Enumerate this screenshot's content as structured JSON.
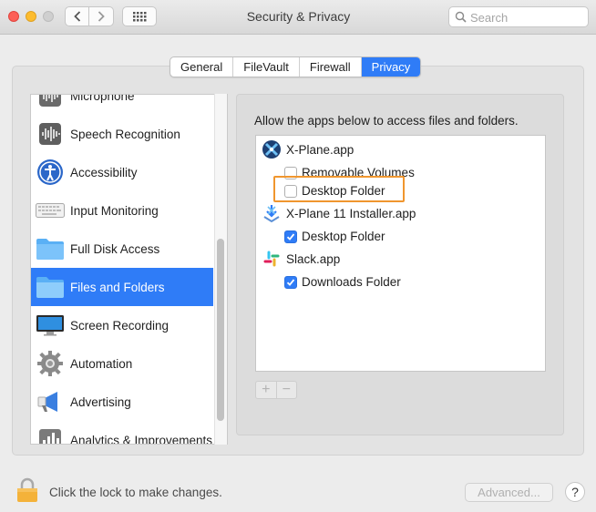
{
  "window": {
    "title": "Security & Privacy"
  },
  "search": {
    "placeholder": "Search"
  },
  "tabs": [
    {
      "label": "General",
      "selected": false
    },
    {
      "label": "FileVault",
      "selected": false
    },
    {
      "label": "Firewall",
      "selected": false
    },
    {
      "label": "Privacy",
      "selected": true
    }
  ],
  "sidebar": {
    "items": [
      {
        "label": "Microphone",
        "icon": "microphone-icon"
      },
      {
        "label": "Speech Recognition",
        "icon": "waveform-icon"
      },
      {
        "label": "Accessibility",
        "icon": "accessibility-icon"
      },
      {
        "label": "Input Monitoring",
        "icon": "keyboard-icon"
      },
      {
        "label": "Full Disk Access",
        "icon": "folder-icon"
      },
      {
        "label": "Files and Folders",
        "icon": "folder-icon",
        "selected": true
      },
      {
        "label": "Screen Recording",
        "icon": "display-icon"
      },
      {
        "label": "Automation",
        "icon": "gear-icon"
      },
      {
        "label": "Advertising",
        "icon": "megaphone-icon"
      },
      {
        "label": "Analytics & Improvements",
        "icon": "chart-icon"
      }
    ]
  },
  "main": {
    "heading": "Allow the apps below to access files and folders.",
    "apps": [
      {
        "name": "X-Plane.app",
        "icon": "xplane-icon",
        "permissions": [
          {
            "label": "Removable Volumes",
            "checked": false
          },
          {
            "label": "Desktop Folder",
            "checked": false
          }
        ]
      },
      {
        "name": "X-Plane 11 Installer.app",
        "icon": "installer-icon",
        "permissions": [
          {
            "label": "Desktop Folder",
            "checked": true
          }
        ]
      },
      {
        "name": "Slack.app",
        "icon": "slack-icon",
        "permissions": [
          {
            "label": "Downloads Folder",
            "checked": true
          }
        ]
      }
    ],
    "add_label": "+",
    "remove_label": "−"
  },
  "footer": {
    "lock_text": "Click the lock to make changes.",
    "advanced_label": "Advanced...",
    "help_label": "?"
  },
  "colors": {
    "accent": "#2f7cf7",
    "highlight": "#f0962e"
  }
}
